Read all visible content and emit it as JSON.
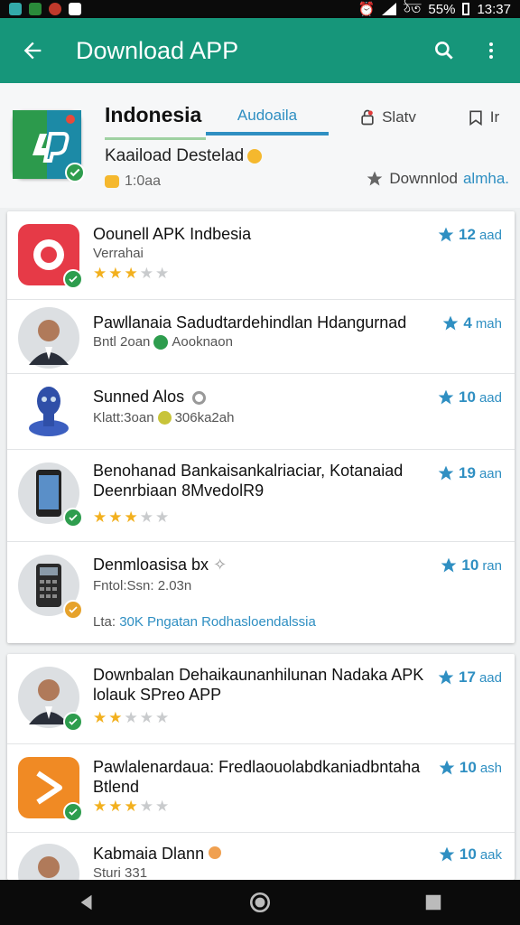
{
  "status_bar": {
    "time": "13:37",
    "battery": "55%",
    "carrier": "ঠত"
  },
  "app_bar": {
    "title": "Download APP"
  },
  "header": {
    "title": "Indonesia",
    "tabs": [
      "Audoaila",
      "Slatv",
      "Ir"
    ],
    "subtitle": "Kaaiload Destelad",
    "meta": "1:0aa",
    "download_label": "Downnlod",
    "download_accent": "almha."
  },
  "list_a": [
    {
      "title": "Oounell APK Indbesia",
      "subtitle": "Verrahai",
      "badge_num": "12",
      "badge_unit": "aad",
      "rating": 3,
      "thumb_color": "#e63a47",
      "check": "green"
    },
    {
      "title": "Pawllanaia Sadudtardehindlan Hdangurnad",
      "subtitle": "Bntl 2oan",
      "subtitle_extra": "Aooknaon",
      "badge_num": "4",
      "badge_unit": "mah",
      "check": "none"
    },
    {
      "title": "Sunned Alos",
      "subtitle": "Klatt:3oan",
      "subtitle_extra": "306ka2ah",
      "badge_num": "10",
      "badge_unit": "aad",
      "check": "none"
    },
    {
      "title": "Benohanad Bankaisankalriaciar, Kotanaiad Deenrbiaan 8MvedolR9",
      "badge_num": "19",
      "badge_unit": "aan",
      "rating": 3,
      "check": "green"
    },
    {
      "title": "Denmloasisa bx",
      "subtitle": "Fntol:Ssn: 2.03n",
      "link_prefix": "Lta: ",
      "link": "30K Pngatan Rodhasloendalssia",
      "badge_num": "10",
      "badge_unit": "ran",
      "check": "orange"
    }
  ],
  "list_b": [
    {
      "title": "Downbalan Dehaikaunanhilunan Nadaka APK lolauk SPreo APP",
      "badge_num": "17",
      "badge_unit": "aad",
      "rating": 2,
      "check": "green"
    },
    {
      "title": "Pawlalenardaua: Fredlaouolabdkaniadbntaha Btlend",
      "badge_num": "10",
      "badge_unit": "ash",
      "rating": 3,
      "thumb_color": "#f08a24",
      "check": "green"
    },
    {
      "title": "Kabmaia Dlann",
      "subtitle": "Sturi 331",
      "badge_num": "10",
      "badge_unit": "aak",
      "check": "none"
    }
  ]
}
